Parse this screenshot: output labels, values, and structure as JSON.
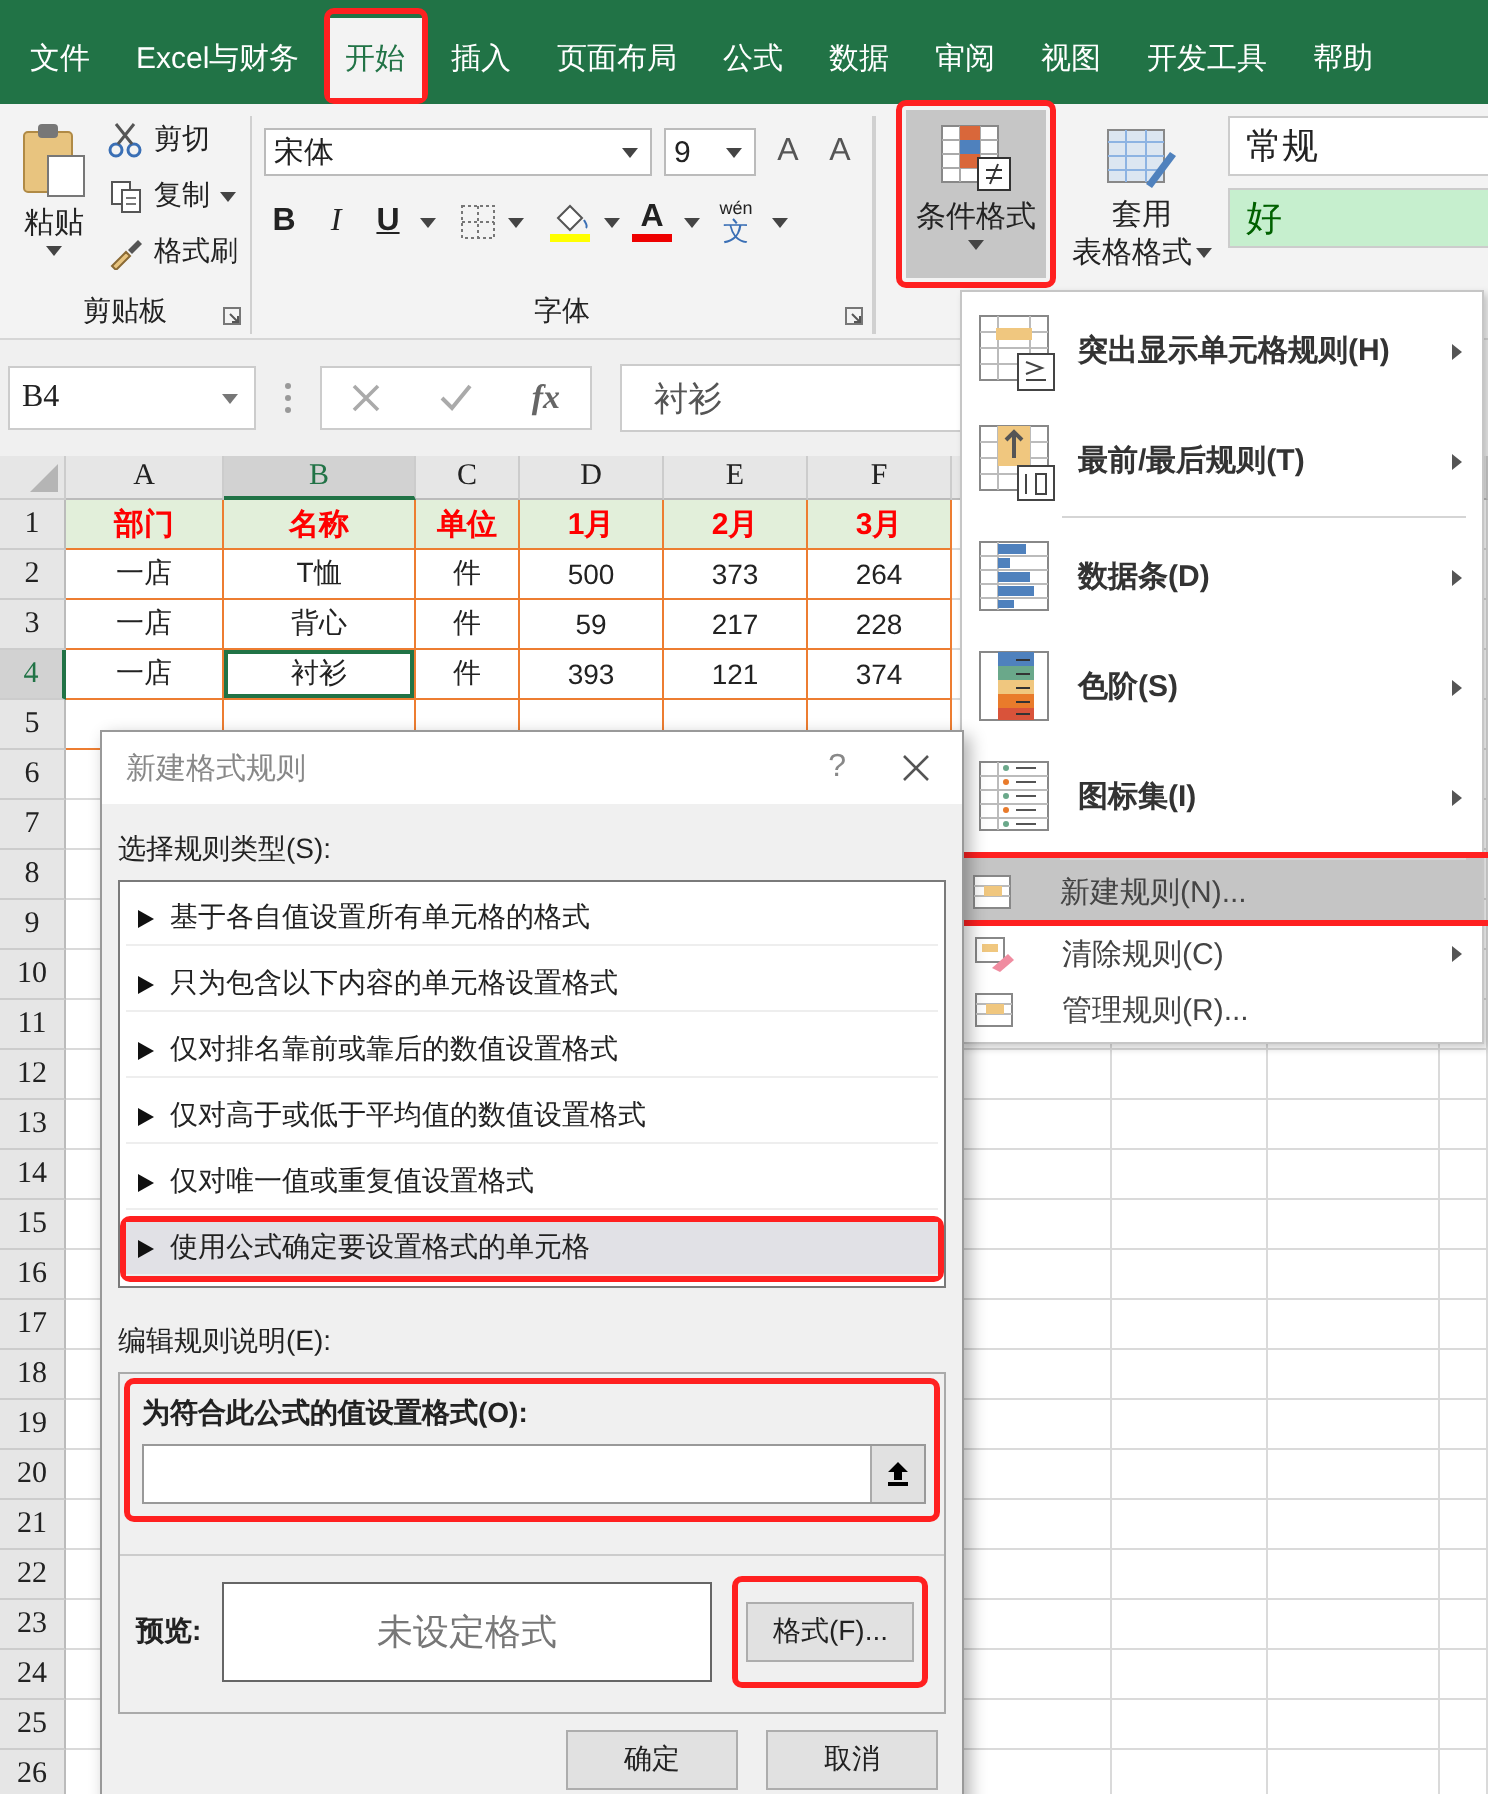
{
  "tabs": [
    {
      "label": "文件",
      "selected": false,
      "highlighted": false
    },
    {
      "label": "Excel与财务",
      "selected": false,
      "highlighted": false
    },
    {
      "label": "开始",
      "selected": true,
      "highlighted": true
    },
    {
      "label": "插入",
      "selected": false,
      "highlighted": false
    },
    {
      "label": "页面布局",
      "selected": false,
      "highlighted": false
    },
    {
      "label": "公式",
      "selected": false,
      "highlighted": false
    },
    {
      "label": "数据",
      "selected": false,
      "highlighted": false
    },
    {
      "label": "审阅",
      "selected": false,
      "highlighted": false
    },
    {
      "label": "视图",
      "selected": false,
      "highlighted": false
    },
    {
      "label": "开发工具",
      "selected": false,
      "highlighted": false
    },
    {
      "label": "帮助",
      "selected": false,
      "highlighted": false
    }
  ],
  "ribbon": {
    "clipboard": {
      "paste": "粘贴",
      "cut": "剪切",
      "copy": "复制",
      "painter": "格式刷",
      "group_label": "剪贴板"
    },
    "font": {
      "family": "宋体",
      "size": "9",
      "grow_glyph": "A",
      "shrink_glyph": "A",
      "bold": "B",
      "italic": "I",
      "underline": "U",
      "font_color_glyph": "A",
      "phonetic_top": "wén",
      "phonetic_main": "文",
      "group_label": "字体"
    },
    "conditional_format": {
      "label": "条件格式",
      "pressed": true,
      "highlighted": true
    },
    "table_format": {
      "line1": "套用",
      "line2": "表格格式"
    },
    "styles": [
      {
        "label": "常规",
        "kind": "normal"
      },
      {
        "label": "好",
        "kind": "good"
      }
    ]
  },
  "formula_bar": {
    "name_box": "B4",
    "fx": "fx",
    "value": "衬衫"
  },
  "columns": [
    {
      "letter": "A",
      "selected": false
    },
    {
      "letter": "B",
      "selected": true
    },
    {
      "letter": "C",
      "selected": false
    },
    {
      "letter": "D",
      "selected": false
    },
    {
      "letter": "E",
      "selected": false
    },
    {
      "letter": "F",
      "selected": false
    }
  ],
  "rows": [
    {
      "number": "1",
      "selected": false,
      "kind": "header",
      "cells": [
        "部门",
        "名称",
        "单位",
        "1月",
        "2月",
        "3月"
      ]
    },
    {
      "number": "2",
      "selected": false,
      "kind": "data",
      "cells": [
        "一店",
        "T恤",
        "件",
        "500",
        "373",
        "264"
      ]
    },
    {
      "number": "3",
      "selected": false,
      "kind": "data",
      "cells": [
        "一店",
        "背心",
        "件",
        "59",
        "217",
        "228"
      ]
    },
    {
      "number": "4",
      "selected": true,
      "kind": "data",
      "cells": [
        "一店",
        "衬衫",
        "件",
        "393",
        "121",
        "374"
      ]
    },
    {
      "number": "5",
      "selected": false,
      "kind": "data"
    },
    {
      "number": "6",
      "selected": false,
      "kind": "empty"
    },
    {
      "number": "7",
      "selected": false,
      "kind": "empty"
    },
    {
      "number": "8",
      "selected": false,
      "kind": "empty"
    },
    {
      "number": "9",
      "selected": false,
      "kind": "empty"
    },
    {
      "number": "10",
      "selected": false,
      "kind": "empty"
    },
    {
      "number": "11",
      "selected": false,
      "kind": "empty"
    },
    {
      "number": "12",
      "selected": false,
      "kind": "empty"
    },
    {
      "number": "13",
      "selected": false,
      "kind": "empty"
    },
    {
      "number": "14",
      "selected": false,
      "kind": "empty"
    },
    {
      "number": "15",
      "selected": false,
      "kind": "empty"
    },
    {
      "number": "16",
      "selected": false,
      "kind": "empty"
    },
    {
      "number": "17",
      "selected": false,
      "kind": "empty"
    },
    {
      "number": "18",
      "selected": false,
      "kind": "empty"
    },
    {
      "number": "19",
      "selected": false,
      "kind": "empty"
    },
    {
      "number": "20",
      "selected": false,
      "kind": "empty"
    },
    {
      "number": "21",
      "selected": false,
      "kind": "empty"
    },
    {
      "number": "22",
      "selected": false,
      "kind": "empty"
    },
    {
      "number": "23",
      "selected": false,
      "kind": "empty"
    },
    {
      "number": "24",
      "selected": false,
      "kind": "empty"
    },
    {
      "number": "25",
      "selected": false,
      "kind": "empty"
    },
    {
      "number": "26",
      "selected": false,
      "kind": "empty"
    }
  ],
  "menu": {
    "items": [
      {
        "kind": "large",
        "label": "突出显示单元格规则(H)",
        "submenu": true,
        "selected": false,
        "highlighted": false,
        "separator_before": false
      },
      {
        "kind": "large",
        "label": "最前/最后规则(T)",
        "submenu": true,
        "selected": false,
        "highlighted": false,
        "separator_before": false
      },
      {
        "kind": "large",
        "label": "数据条(D)",
        "submenu": true,
        "selected": false,
        "highlighted": false,
        "separator_before": true
      },
      {
        "kind": "large",
        "label": "色阶(S)",
        "submenu": true,
        "selected": false,
        "highlighted": false,
        "separator_before": false
      },
      {
        "kind": "large",
        "label": "图标集(I)",
        "submenu": true,
        "selected": false,
        "highlighted": false,
        "separator_before": false
      },
      {
        "kind": "small",
        "label": "新建规则(N)...",
        "submenu": false,
        "selected": true,
        "highlighted": true,
        "separator_before": true
      },
      {
        "kind": "small",
        "label": "清除规则(C)",
        "submenu": true,
        "selected": false,
        "highlighted": false,
        "separator_before": false
      },
      {
        "kind": "small",
        "label": "管理规则(R)...",
        "submenu": false,
        "selected": false,
        "highlighted": false,
        "separator_before": false
      }
    ]
  },
  "dialog": {
    "title": "新建格式规则",
    "help": "?",
    "type_label": "选择规则类型(S):",
    "rule_types": [
      {
        "label": "基于各自值设置所有单元格的格式",
        "selected": false,
        "highlighted": false
      },
      {
        "label": "只为包含以下内容的单元格设置格式",
        "selected": false,
        "highlighted": false
      },
      {
        "label": "仅对排名靠前或靠后的数值设置格式",
        "selected": false,
        "highlighted": false
      },
      {
        "label": "仅对高于或低于平均值的数值设置格式",
        "selected": false,
        "highlighted": false
      },
      {
        "label": "仅对唯一值或重复值设置格式",
        "selected": false,
        "highlighted": false
      },
      {
        "label": "使用公式确定要设置格式的单元格",
        "selected": true,
        "highlighted": true
      }
    ],
    "edit_label": "编辑规则说明(E):",
    "formula_section": {
      "label": "为符合此公式的值设置格式(O):",
      "highlighted": true
    },
    "preview_label": "预览:",
    "preview_text": "未设定格式",
    "format_button": {
      "label": "格式(F)...",
      "highlighted": true
    },
    "ok": "确定",
    "cancel": "取消"
  }
}
